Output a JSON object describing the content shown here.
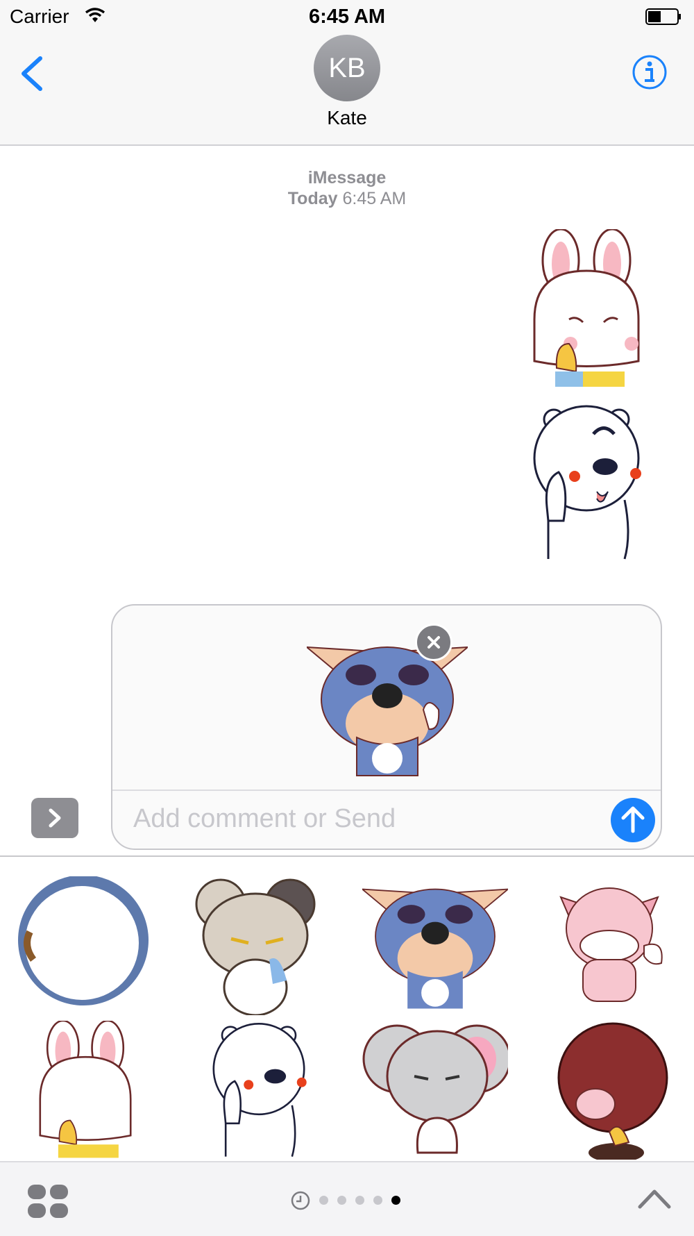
{
  "status_bar": {
    "carrier": "Carrier",
    "time": "6:45 AM"
  },
  "header": {
    "avatar_initials": "KB",
    "contact_name": "Kate"
  },
  "conversation": {
    "service": "iMessage",
    "day": "Today",
    "time": "6:45 AM"
  },
  "composer": {
    "placeholder": "Add comment or Send"
  },
  "colors": {
    "accent": "#1a82fb",
    "bg": "#ffffff",
    "bar": "#f7f7f7"
  },
  "icons": [
    "back-chevron-icon",
    "info-icon",
    "wifi-icon",
    "battery-icon",
    "send-arrow-icon",
    "close-icon",
    "apps-chevron-icon",
    "grid-icon",
    "recents-clock-icon",
    "chevron-up-icon"
  ],
  "sticker_drawer": {
    "page_count": 6,
    "active_page": 6
  }
}
